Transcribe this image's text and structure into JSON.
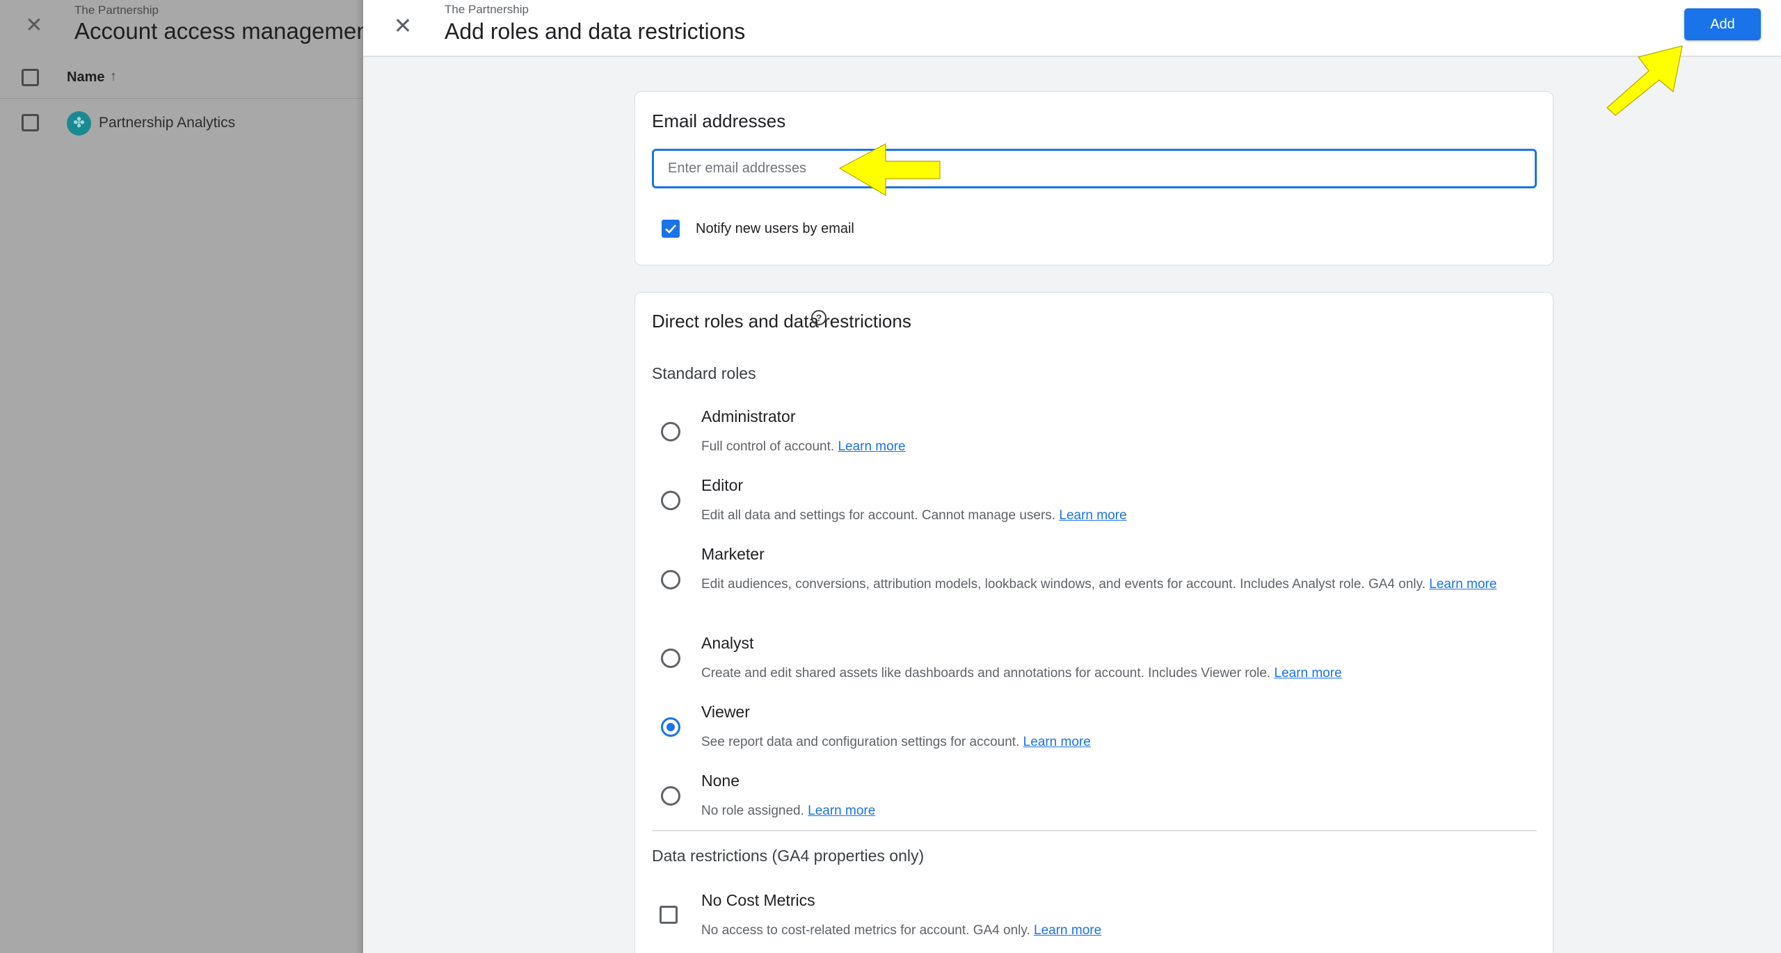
{
  "background_page": {
    "subtitle": "The Partnership",
    "title": "Account access management",
    "table": {
      "columns": [
        {
          "label": "Name",
          "sort": "ascending",
          "sort_icon": "arrow-up-icon"
        }
      ],
      "rows": [
        {
          "name": "Partnership Analytics",
          "icon": "analytics-logo-icon",
          "checked": false
        }
      ]
    }
  },
  "dialog": {
    "subtitle": "The Partnership",
    "title": "Add roles and data restrictions",
    "close_icon": "close-icon",
    "add_label": "Add",
    "colors": {
      "primary": "#1a73e8",
      "annotation_arrow": "#ffff00"
    }
  },
  "email_card": {
    "title": "Email addresses",
    "input_placeholder": "Enter email addresses",
    "input_value": "",
    "notify_label": "Notify new users by email",
    "notify_checked": true
  },
  "roles_card": {
    "title": "Direct roles and data restrictions",
    "help_icon": "help-circle-icon",
    "help_glyph": "?",
    "standard_roles_label": "Standard roles",
    "learn_more": "Learn more",
    "selected_role": "Viewer",
    "roles": [
      {
        "name": "Administrator",
        "description": "Full control of account.",
        "selected": false
      },
      {
        "name": "Editor",
        "description": "Edit all data and settings for account. Cannot manage users.",
        "selected": false
      },
      {
        "name": "Marketer",
        "description": "Edit audiences, conversions, attribution models, lookback windows, and events for account. Includes Analyst role. GA4 only.",
        "selected": false
      },
      {
        "name": "Analyst",
        "description": "Create and edit shared assets like dashboards and annotations for account. Includes Viewer role.",
        "selected": false
      },
      {
        "name": "Viewer",
        "description": "See report data and configuration settings for account.",
        "selected": true
      },
      {
        "name": "None",
        "description": "No role assigned.",
        "selected": false
      }
    ],
    "data_restrictions_label": "Data restrictions (GA4 properties only)",
    "restrictions": [
      {
        "name": "No Cost Metrics",
        "description": "No access to cost-related metrics for account. GA4 only.",
        "checked": false
      }
    ]
  }
}
